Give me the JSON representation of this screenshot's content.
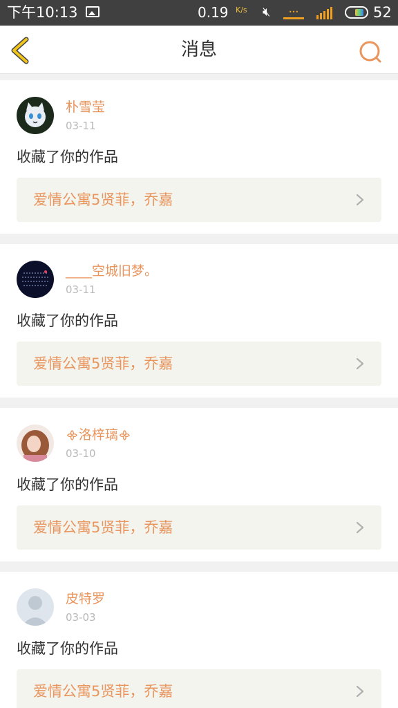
{
  "status_bar": {
    "time": "下午10:13",
    "net_speed": "0.19",
    "speed_unit": "K/s",
    "network": "4G",
    "battery_level": "52"
  },
  "header": {
    "title": "消息",
    "back_icon": "chevron-left-icon",
    "search_icon": "search-icon"
  },
  "colors": {
    "accent": "#e8955e",
    "back_arrow": "#f0c419",
    "card_link_bg": "#f4f4ee"
  },
  "messages": [
    {
      "name": "朴雪莹",
      "date": "03-11",
      "action": "收藏了你的作品",
      "work_title": "爱情公寓5贤菲，乔嘉"
    },
    {
      "name": "____空城旧梦。",
      "date": "03-11",
      "action": "收藏了你的作品",
      "work_title": "爱情公寓5贤菲，乔嘉"
    },
    {
      "name": "洛梓璃",
      "date": "03-10",
      "action": "收藏了你的作品",
      "work_title": "爱情公寓5贤菲，乔嘉"
    },
    {
      "name": "皮特罗",
      "date": "03-03",
      "action": "收藏了你的作品",
      "work_title": "爱情公寓5贤菲，乔嘉"
    }
  ]
}
